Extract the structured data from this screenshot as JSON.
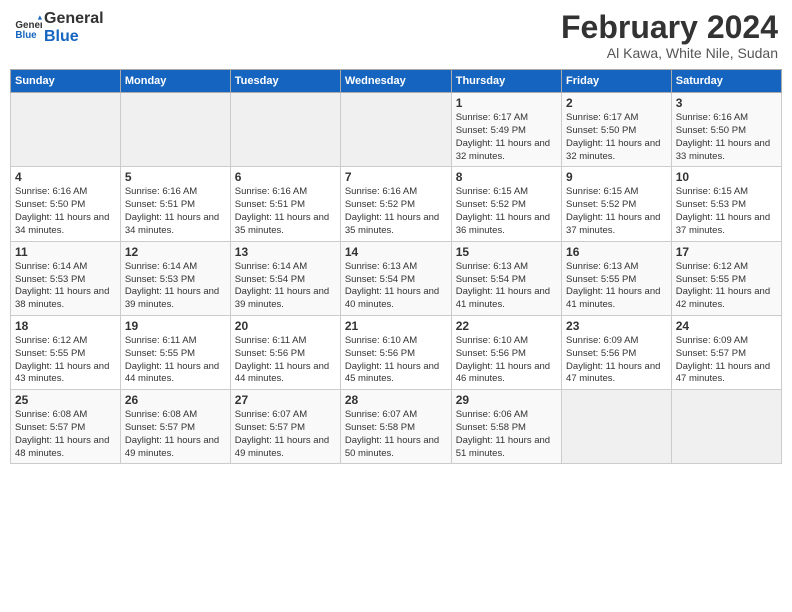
{
  "logo": {
    "line1": "General",
    "line2": "Blue"
  },
  "title": "February 2024",
  "location": "Al Kawa, White Nile, Sudan",
  "weekdays": [
    "Sunday",
    "Monday",
    "Tuesday",
    "Wednesday",
    "Thursday",
    "Friday",
    "Saturday"
  ],
  "weeks": [
    [
      {
        "day": "",
        "sunrise": "",
        "sunset": "",
        "daylight": ""
      },
      {
        "day": "",
        "sunrise": "",
        "sunset": "",
        "daylight": ""
      },
      {
        "day": "",
        "sunrise": "",
        "sunset": "",
        "daylight": ""
      },
      {
        "day": "",
        "sunrise": "",
        "sunset": "",
        "daylight": ""
      },
      {
        "day": "1",
        "sunrise": "Sunrise: 6:17 AM",
        "sunset": "Sunset: 5:49 PM",
        "daylight": "Daylight: 11 hours and 32 minutes."
      },
      {
        "day": "2",
        "sunrise": "Sunrise: 6:17 AM",
        "sunset": "Sunset: 5:50 PM",
        "daylight": "Daylight: 11 hours and 32 minutes."
      },
      {
        "day": "3",
        "sunrise": "Sunrise: 6:16 AM",
        "sunset": "Sunset: 5:50 PM",
        "daylight": "Daylight: 11 hours and 33 minutes."
      }
    ],
    [
      {
        "day": "4",
        "sunrise": "Sunrise: 6:16 AM",
        "sunset": "Sunset: 5:50 PM",
        "daylight": "Daylight: 11 hours and 34 minutes."
      },
      {
        "day": "5",
        "sunrise": "Sunrise: 6:16 AM",
        "sunset": "Sunset: 5:51 PM",
        "daylight": "Daylight: 11 hours and 34 minutes."
      },
      {
        "day": "6",
        "sunrise": "Sunrise: 6:16 AM",
        "sunset": "Sunset: 5:51 PM",
        "daylight": "Daylight: 11 hours and 35 minutes."
      },
      {
        "day": "7",
        "sunrise": "Sunrise: 6:16 AM",
        "sunset": "Sunset: 5:52 PM",
        "daylight": "Daylight: 11 hours and 35 minutes."
      },
      {
        "day": "8",
        "sunrise": "Sunrise: 6:15 AM",
        "sunset": "Sunset: 5:52 PM",
        "daylight": "Daylight: 11 hours and 36 minutes."
      },
      {
        "day": "9",
        "sunrise": "Sunrise: 6:15 AM",
        "sunset": "Sunset: 5:52 PM",
        "daylight": "Daylight: 11 hours and 37 minutes."
      },
      {
        "day": "10",
        "sunrise": "Sunrise: 6:15 AM",
        "sunset": "Sunset: 5:53 PM",
        "daylight": "Daylight: 11 hours and 37 minutes."
      }
    ],
    [
      {
        "day": "11",
        "sunrise": "Sunrise: 6:14 AM",
        "sunset": "Sunset: 5:53 PM",
        "daylight": "Daylight: 11 hours and 38 minutes."
      },
      {
        "day": "12",
        "sunrise": "Sunrise: 6:14 AM",
        "sunset": "Sunset: 5:53 PM",
        "daylight": "Daylight: 11 hours and 39 minutes."
      },
      {
        "day": "13",
        "sunrise": "Sunrise: 6:14 AM",
        "sunset": "Sunset: 5:54 PM",
        "daylight": "Daylight: 11 hours and 39 minutes."
      },
      {
        "day": "14",
        "sunrise": "Sunrise: 6:13 AM",
        "sunset": "Sunset: 5:54 PM",
        "daylight": "Daylight: 11 hours and 40 minutes."
      },
      {
        "day": "15",
        "sunrise": "Sunrise: 6:13 AM",
        "sunset": "Sunset: 5:54 PM",
        "daylight": "Daylight: 11 hours and 41 minutes."
      },
      {
        "day": "16",
        "sunrise": "Sunrise: 6:13 AM",
        "sunset": "Sunset: 5:55 PM",
        "daylight": "Daylight: 11 hours and 41 minutes."
      },
      {
        "day": "17",
        "sunrise": "Sunrise: 6:12 AM",
        "sunset": "Sunset: 5:55 PM",
        "daylight": "Daylight: 11 hours and 42 minutes."
      }
    ],
    [
      {
        "day": "18",
        "sunrise": "Sunrise: 6:12 AM",
        "sunset": "Sunset: 5:55 PM",
        "daylight": "Daylight: 11 hours and 43 minutes."
      },
      {
        "day": "19",
        "sunrise": "Sunrise: 6:11 AM",
        "sunset": "Sunset: 5:55 PM",
        "daylight": "Daylight: 11 hours and 44 minutes."
      },
      {
        "day": "20",
        "sunrise": "Sunrise: 6:11 AM",
        "sunset": "Sunset: 5:56 PM",
        "daylight": "Daylight: 11 hours and 44 minutes."
      },
      {
        "day": "21",
        "sunrise": "Sunrise: 6:10 AM",
        "sunset": "Sunset: 5:56 PM",
        "daylight": "Daylight: 11 hours and 45 minutes."
      },
      {
        "day": "22",
        "sunrise": "Sunrise: 6:10 AM",
        "sunset": "Sunset: 5:56 PM",
        "daylight": "Daylight: 11 hours and 46 minutes."
      },
      {
        "day": "23",
        "sunrise": "Sunrise: 6:09 AM",
        "sunset": "Sunset: 5:56 PM",
        "daylight": "Daylight: 11 hours and 47 minutes."
      },
      {
        "day": "24",
        "sunrise": "Sunrise: 6:09 AM",
        "sunset": "Sunset: 5:57 PM",
        "daylight": "Daylight: 11 hours and 47 minutes."
      }
    ],
    [
      {
        "day": "25",
        "sunrise": "Sunrise: 6:08 AM",
        "sunset": "Sunset: 5:57 PM",
        "daylight": "Daylight: 11 hours and 48 minutes."
      },
      {
        "day": "26",
        "sunrise": "Sunrise: 6:08 AM",
        "sunset": "Sunset: 5:57 PM",
        "daylight": "Daylight: 11 hours and 49 minutes."
      },
      {
        "day": "27",
        "sunrise": "Sunrise: 6:07 AM",
        "sunset": "Sunset: 5:57 PM",
        "daylight": "Daylight: 11 hours and 49 minutes."
      },
      {
        "day": "28",
        "sunrise": "Sunrise: 6:07 AM",
        "sunset": "Sunset: 5:58 PM",
        "daylight": "Daylight: 11 hours and 50 minutes."
      },
      {
        "day": "29",
        "sunrise": "Sunrise: 6:06 AM",
        "sunset": "Sunset: 5:58 PM",
        "daylight": "Daylight: 11 hours and 51 minutes."
      },
      {
        "day": "",
        "sunrise": "",
        "sunset": "",
        "daylight": ""
      },
      {
        "day": "",
        "sunrise": "",
        "sunset": "",
        "daylight": ""
      }
    ]
  ]
}
